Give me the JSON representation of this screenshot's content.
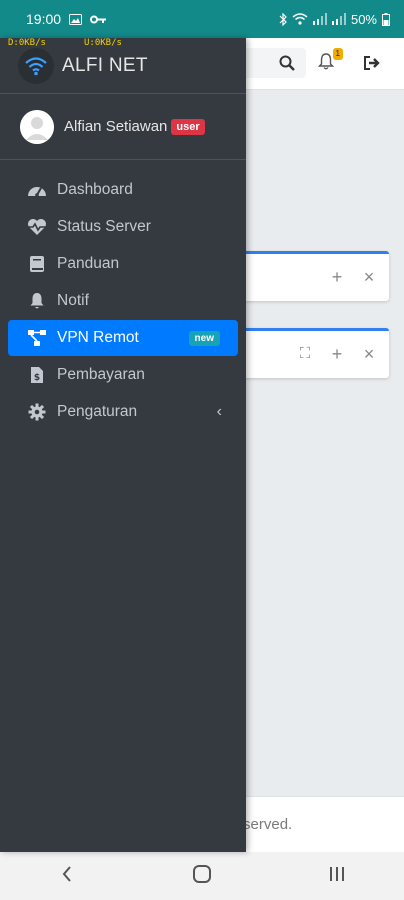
{
  "status_bar": {
    "time": "19:00",
    "battery": "50%"
  },
  "speed": {
    "download": "D:0KB/s",
    "upload": "U:0KB/s"
  },
  "colors": {
    "status_bar": "#138a8a",
    "sidebar_bg": "#343a40",
    "active_item": "#007bff",
    "user_badge": "#dc3545",
    "new_badge": "#17a2b8",
    "card_accent": "#2f80ed"
  },
  "topnav": {
    "notification_count": "1",
    "icons": [
      "search-icon",
      "bell-icon",
      "logout-icon"
    ]
  },
  "sidebar": {
    "brand": "ALFI NET",
    "user": {
      "name": "Alfian Setiawan",
      "badge": "user"
    },
    "items": [
      {
        "label": "Dashboard",
        "icon": "tachometer-icon"
      },
      {
        "label": "Status Server",
        "icon": "heartbeat-icon"
      },
      {
        "label": "Panduan",
        "icon": "book-icon"
      },
      {
        "label": "Notif",
        "icon": "bell-icon"
      },
      {
        "label": "VPN Remot",
        "icon": "network-icon",
        "badge": "new",
        "active": true
      },
      {
        "label": "Pembayaran",
        "icon": "invoice-icon"
      },
      {
        "label": "Pengaturan",
        "icon": "gear-icon",
        "caret": "‹"
      }
    ]
  },
  "cards": [
    {
      "tools": [
        "+",
        "×"
      ]
    },
    {
      "tools": [
        "⛶",
        "+",
        "×"
      ]
    }
  ],
  "footer": {
    "text": "All rights reserved."
  }
}
